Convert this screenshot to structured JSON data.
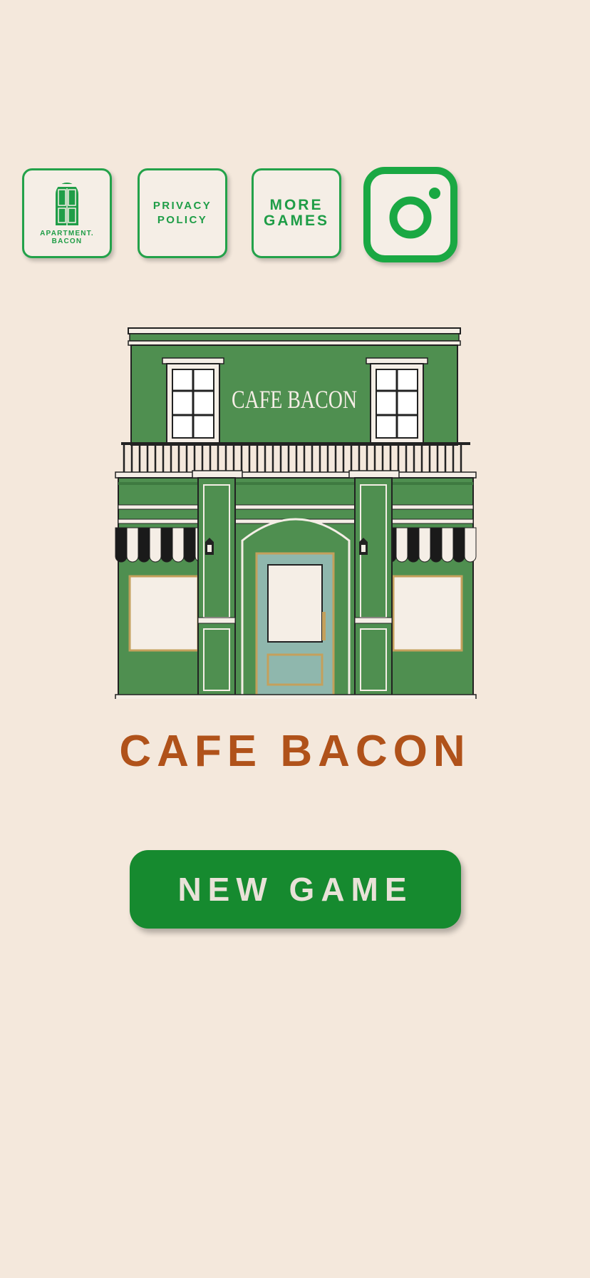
{
  "top_buttons": {
    "apartment_label_line1": "APARTMENT.",
    "apartment_label_line2": "BACON",
    "privacy_line1": "PRIVACY",
    "privacy_line2": "POLICY",
    "more_line1": "MORE",
    "more_line2": "GAMES",
    "instagram_icon": "instagram-icon"
  },
  "illustration": {
    "sign_text": "CAFE BACON"
  },
  "title": "CAFE BACON",
  "new_game_label": "NEW GAME",
  "colors": {
    "background": "#f4e8dc",
    "accent_green": "#1f9d47",
    "building_green": "#4f8f50",
    "title_orange": "#b0521a",
    "button_green": "#168a2f"
  }
}
